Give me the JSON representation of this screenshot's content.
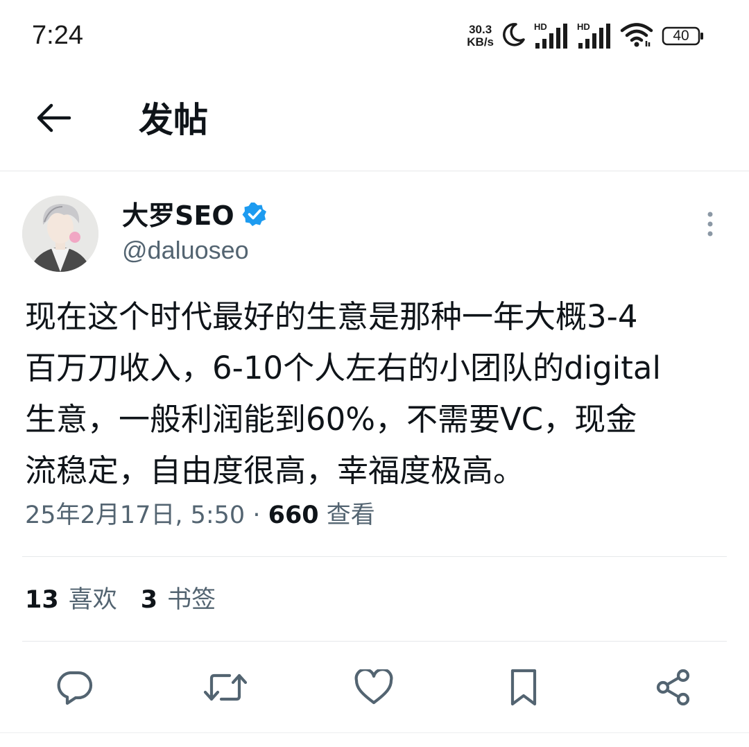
{
  "status_bar": {
    "time": "7:24",
    "net_speed_value": "30.3",
    "net_speed_unit": "KB/s",
    "hd_label_1": "HD",
    "hd_label_2": "HD",
    "battery_level": "40"
  },
  "header": {
    "title": "发帖"
  },
  "tweet": {
    "author_name": "大罗SEO",
    "author_handle": "@daluoseo",
    "text": "现在这个时代最好的生意是那种一年大概3-4\n百万刀收入，6-10个人左右的小团队的digital\n生意，一般利润能到60%，不需要VC，现金\n流稳定，自由度很高，幸福度极高。",
    "timestamp": "25年2月17日, 5:50",
    "separator": " · ",
    "views_count": "660",
    "views_label": "查看",
    "likes_count": "13",
    "likes_label": "喜欢",
    "bookmarks_count": "3",
    "bookmarks_label": "书签"
  },
  "colors": {
    "text_primary": "#0f1419",
    "text_secondary": "#536471",
    "verified_badge": "#1d9bf0",
    "divider": "#e6e8ea"
  },
  "icons": {
    "back": "arrow-left-icon",
    "verified": "verified-badge-icon",
    "more": "more-vertical-icon",
    "reply": "reply-icon",
    "retweet": "retweet-icon",
    "like": "heart-icon",
    "bookmark": "bookmark-icon",
    "share": "share-icon"
  }
}
